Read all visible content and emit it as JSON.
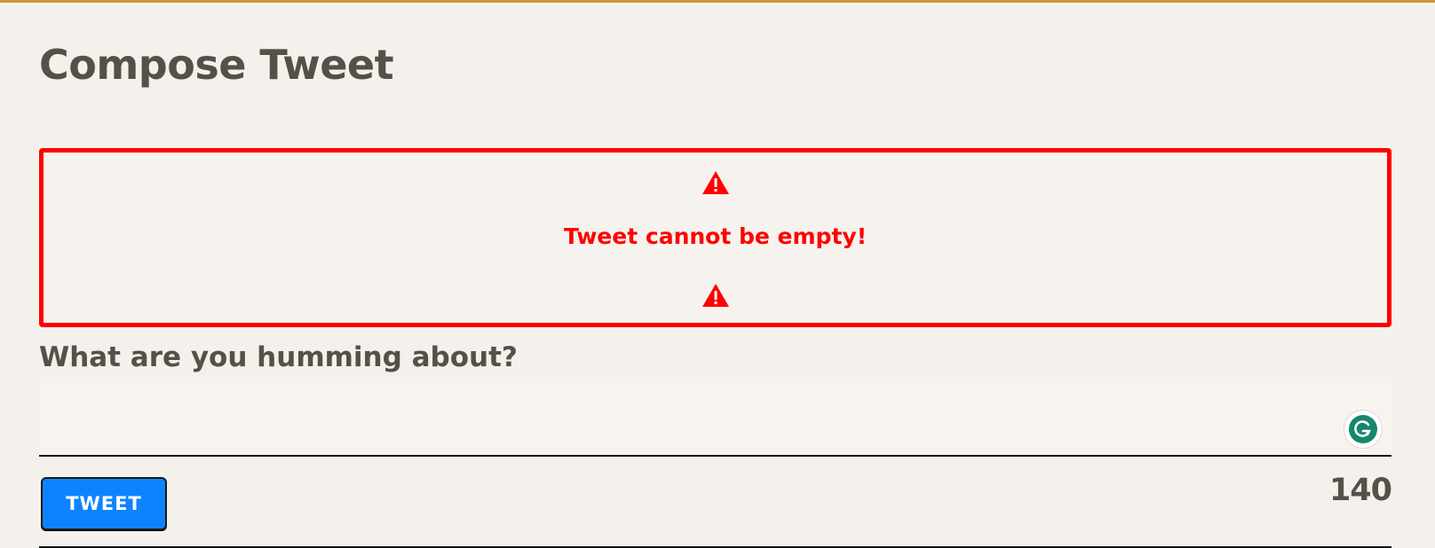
{
  "page": {
    "title": "Compose Tweet"
  },
  "alert": {
    "message": "Tweet cannot be empty!",
    "icon": "warning-triangle-icon",
    "color": "#ff0000"
  },
  "composer": {
    "prompt": "What are you humming about?",
    "value": "",
    "assistant_icon": "grammarly-icon"
  },
  "actions": {
    "tweet_label": "TWEET"
  },
  "counter": {
    "remaining": "140"
  },
  "colors": {
    "accent_bar": "#d4962e",
    "button": "#0f83ff",
    "text": "#545149",
    "background": "#f4f1ec"
  }
}
